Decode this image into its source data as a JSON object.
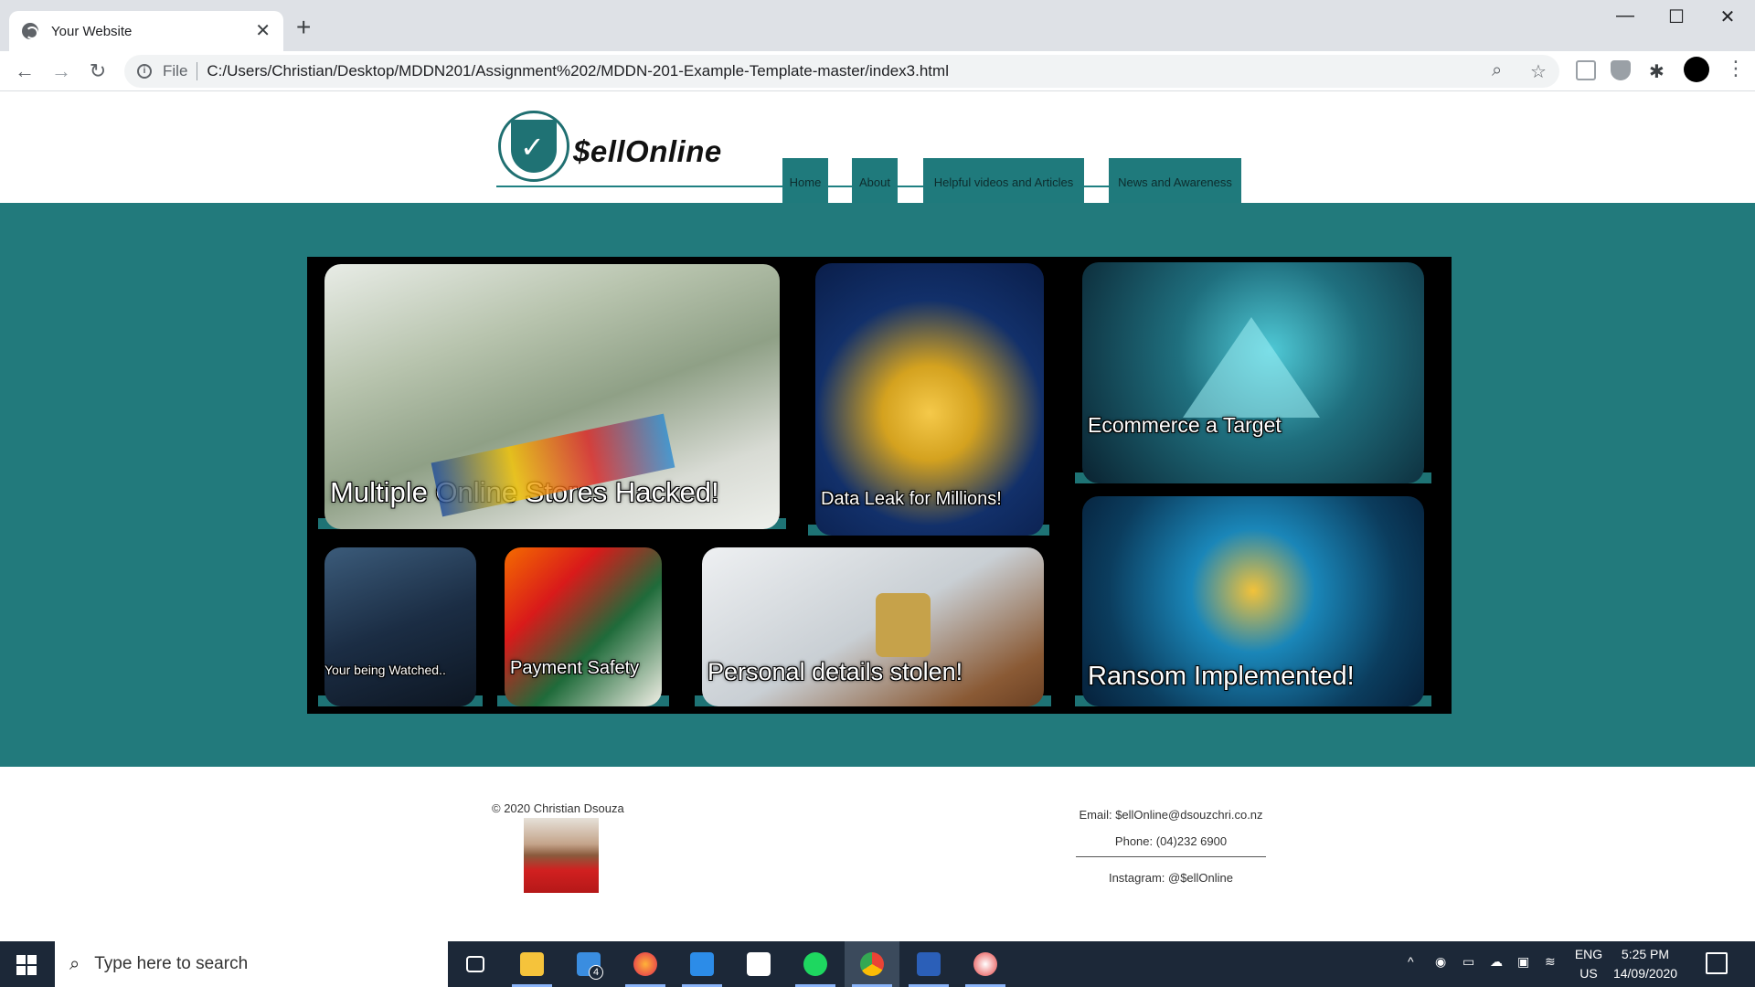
{
  "browser": {
    "tab_title": "Your Website",
    "file_label": "File",
    "url": "C:/Users/Christian/Desktop/MDDN201/Assignment%202/MDDN-201-Example-Template-master/index3.html"
  },
  "site": {
    "logo_text": "$ellOnline",
    "nav": [
      "Home",
      "About",
      "Helpful videos and Articles",
      "News and Awareness"
    ]
  },
  "gallery": {
    "tiles": [
      {
        "caption": "Multiple Online Stores Hacked!",
        "image": "cash-and-credit-cards"
      },
      {
        "caption": "Data Leak for Millions!",
        "image": "folder-with-padlock"
      },
      {
        "caption": "Ecommerce a Target",
        "image": "warning-triangle-binary"
      },
      {
        "caption": "Your being Watched..",
        "image": "hooded-hacker"
      },
      {
        "caption": "Payment Safety",
        "image": "mastercard-visa-cards"
      },
      {
        "caption": "Personal details stolen!",
        "image": "card-keyboard-padlock"
      },
      {
        "caption": "Ransom Implemented!",
        "image": "system-hacked-screen"
      }
    ]
  },
  "footer": {
    "copyright": "© 2020 Christian Dsouza",
    "email": "Email: $ellOnline@dsouzchri.co.nz",
    "phone": "Phone: (04)232 6900",
    "instagram": "Instagram: @$ellOnline"
  },
  "taskbar": {
    "search_placeholder": "Type here to search",
    "mail_badge": "4",
    "lang_top": "ENG",
    "lang_bottom": "US",
    "time": "5:25 PM",
    "date": "14/09/2020"
  },
  "colors": {
    "teal": "#227a7c",
    "nav_bg": "#1f7a7c",
    "taskbar": "#1c2838"
  }
}
